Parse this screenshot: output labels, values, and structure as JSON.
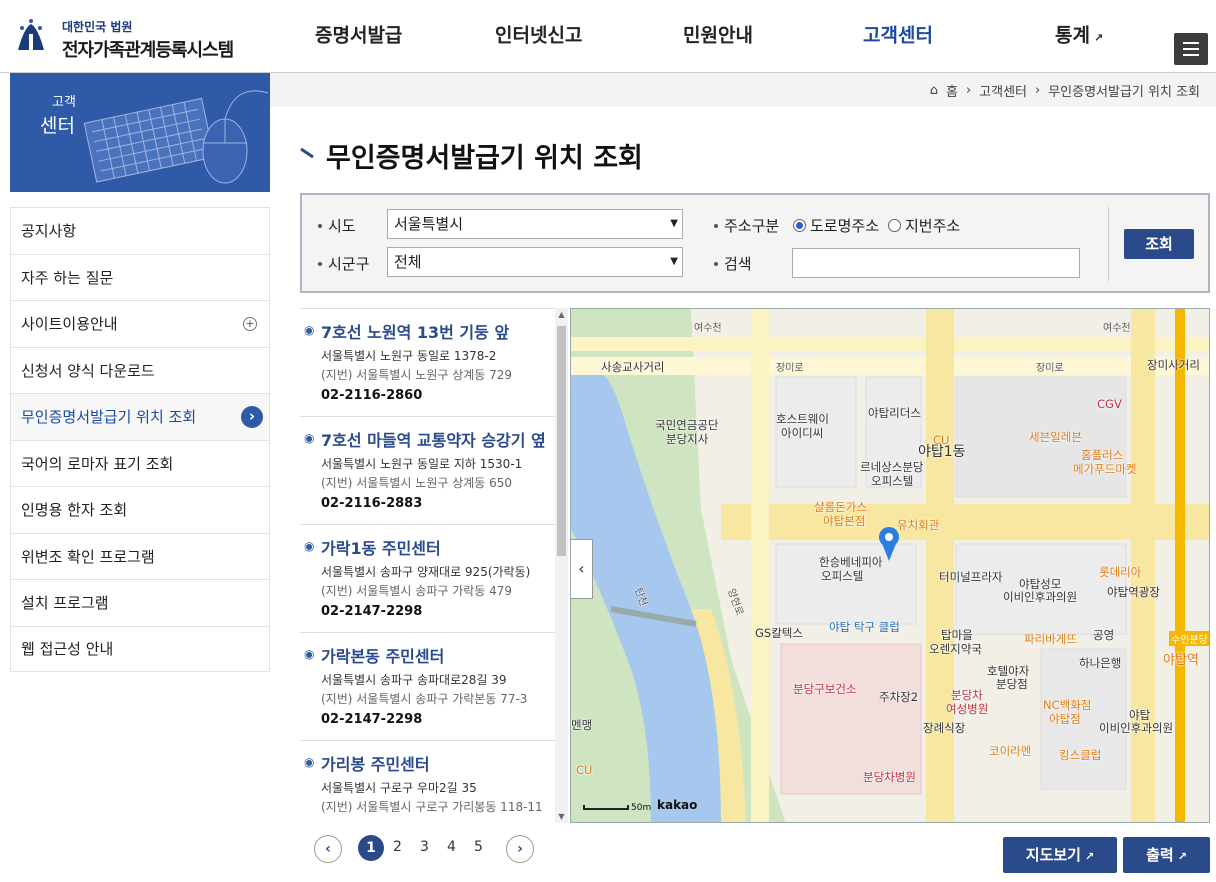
{
  "header": {
    "org": "대한민국 법원",
    "system_name": "전자가족관계등록시스템",
    "nav": [
      "증명서발급",
      "인터넷신고",
      "민원안내",
      "고객센터",
      "통계"
    ],
    "active_nav": "고객센터"
  },
  "sidebar": {
    "banner_line1": "고객",
    "banner_line2": "센터",
    "items": [
      {
        "label": "공지사항"
      },
      {
        "label": "자주 하는 질문"
      },
      {
        "label": "사이트이용안내"
      },
      {
        "label": "신청서 양식 다운로드"
      },
      {
        "label": "무인증명서발급기 위치 조회"
      },
      {
        "label": "국어의 로마자 표기 조회"
      },
      {
        "label": "인명용 한자 조회"
      },
      {
        "label": "위변조 확인 프로그램"
      },
      {
        "label": "설치 프로그램"
      },
      {
        "label": "웹 접근성 안내"
      }
    ]
  },
  "breadcrumb": [
    "홈",
    "고객센터",
    "무인증명서발급기 위치 조회"
  ],
  "page_title": "무인증명서발급기 위치 조회",
  "search": {
    "sido_label": "시도",
    "sido_value": "서울특별시",
    "sigungu_label": "시군구",
    "sigungu_value": "전체",
    "addr_type_label": "주소구분",
    "road_label": "도로명주소",
    "jibun_label": "지번주소",
    "keyword_label": "검색",
    "keyword_value": "",
    "submit_label": "조회"
  },
  "results": [
    {
      "name": "7호선 노원역 13번 기둥 앞",
      "addr": "서울특별시 노원구 동일로 1378-2",
      "jibun": "(지번) 서울특별시 노원구 상계동 729",
      "tel": "02-2116-2860"
    },
    {
      "name": "7호선 마들역 교통약자 승강기 옆",
      "addr": "서울특별시 노원구 동일로 지하 1530-1",
      "jibun": "(지번) 서울특별시 노원구 상계동 650",
      "tel": "02-2116-2883"
    },
    {
      "name": "가락1동 주민센터",
      "addr": "서울특별시 송파구 양재대로 925(가락동)",
      "jibun": "(지번) 서울특별시 송파구 가락동 479",
      "tel": "02-2147-2298"
    },
    {
      "name": "가락본동 주민센터",
      "addr": "서울특별시 송파구 송파대로28길 39",
      "jibun": "(지번) 서울특별시 송파구 가락본동 77-3",
      "tel": "02-2147-2298"
    },
    {
      "name": "가리봉 주민센터",
      "addr": "서울특별시 구로구 우마2길 35",
      "jibun": "(지번) 서울특별시 구로구 가리봉동 118-11",
      "tel": ""
    }
  ],
  "pagination": {
    "pages": [
      "1",
      "2",
      "3",
      "4",
      "5"
    ],
    "current": "1"
  },
  "map": {
    "scale": "50m",
    "provider": "kakao",
    "labels": [
      "여수천",
      "여수천",
      "사송교사거리",
      "장미로",
      "장미로",
      "장미사거리",
      "국민연금공단",
      "분당지사",
      "호스트웨이",
      "아이디씨",
      "야탑리더스",
      "CGV",
      "세븐일레븐",
      "홈플러스",
      "메가푸드마켓",
      "CU",
      "야탑1동",
      "르네상스분당",
      "오피스텔",
      "샬롬돈가스",
      "야탑본점",
      "유치회관",
      "한승베네피아",
      "오피스텔",
      "터미널프라자",
      "롯데리아",
      "야탑성모",
      "이비인후과의원",
      "야탑역광장",
      "GS칼텍스",
      "야탑 탁구 클럽",
      "탑마을",
      "오렌지약국",
      "파리바게뜨",
      "공영",
      "수인분당",
      "야탑역",
      "하나은행",
      "호텔야자",
      "분당점",
      "분당구보건소",
      "주차장2",
      "분당차",
      "여성병원",
      "NC백화점",
      "야탑점",
      "야탑",
      "이비인후과의원",
      "장례식장",
      "코이라멘",
      "킹스클럽",
      "분당차병원",
      "CU",
      "탄천",
      "양현로",
      "멘맹"
    ]
  },
  "buttons": {
    "map_view": "지도보기",
    "print": "출력"
  },
  "colors": {
    "brand": "#2b4a8a",
    "accent": "#2f5aa7",
    "subway_line": "#f5b800",
    "river": "#a6c8ee",
    "park": "#cfe4c0"
  }
}
